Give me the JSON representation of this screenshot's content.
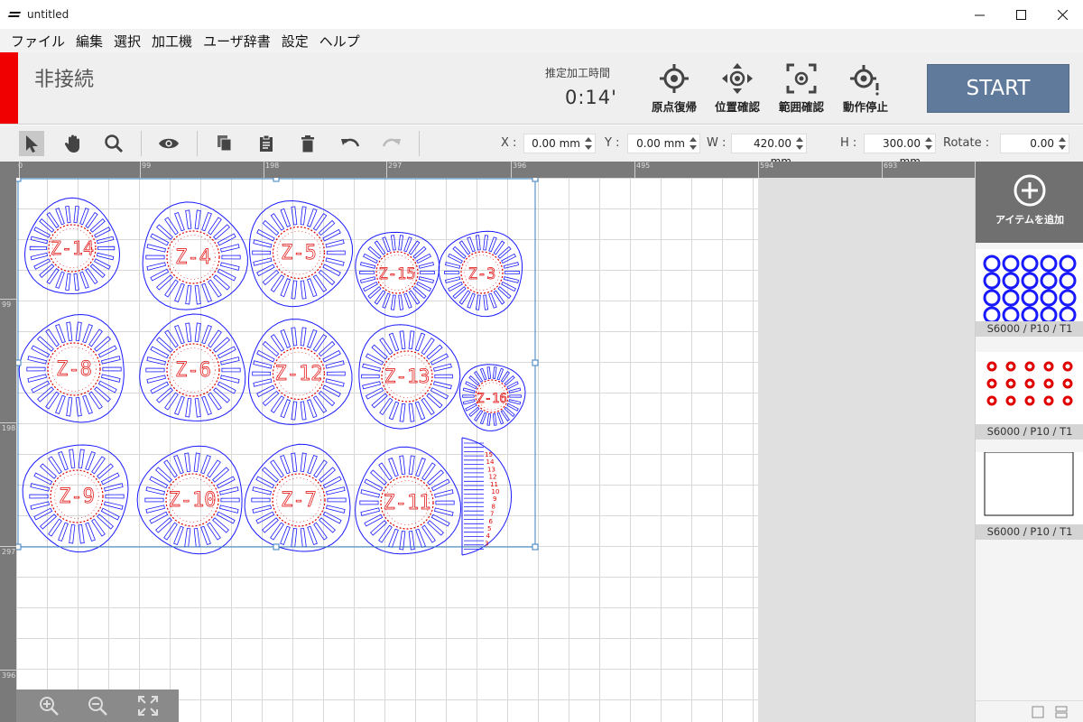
{
  "window": {
    "title": "untitled"
  },
  "menu": [
    "ファイル",
    "編集",
    "選択",
    "加工機",
    "ユーザ辞書",
    "設定",
    "ヘルプ"
  ],
  "header": {
    "connection_status": "非接続",
    "estimated_time_label": "推定加工時間",
    "estimated_time": "0:14'",
    "buttons": [
      "原点復帰",
      "位置確認",
      "範囲確認",
      "動作停止"
    ],
    "start_label": "START",
    "status_color": "#f00000"
  },
  "transform": {
    "x_label": "X :",
    "x_value": "0.00 mm",
    "y_label": "Y :",
    "y_value": "0.00 mm",
    "w_label": "W :",
    "w_value": "420.00 mm",
    "h_label": "H :",
    "h_value": "300.00 mm",
    "rotate_label": "Rotate :",
    "rotate_value": "0.00"
  },
  "rulers": {
    "top": [
      "0",
      "99",
      "198",
      "297",
      "396",
      "495",
      "594",
      "693"
    ],
    "left": [
      "99",
      "198",
      "297",
      "396"
    ]
  },
  "parts": [
    "Z-14",
    "Z-4",
    "Z-5",
    "Z-15",
    "Z-3",
    "Z-8",
    "Z-6",
    "Z-12",
    "Z-13",
    "Z-16",
    "Z-9",
    "Z-10",
    "Z-7",
    "Z-11"
  ],
  "side_labels": [
    "15",
    "14",
    "13",
    "12",
    "11",
    "10",
    "9",
    "8",
    "7",
    "6",
    "5",
    "4",
    "3"
  ],
  "right_panel": {
    "add_item_label": "アイテムを追加",
    "layers": [
      {
        "caption": "S6000 / P10 / T1",
        "color": "#1a1aff"
      },
      {
        "caption": "S6000 / P10 / T1",
        "color": "#e00000"
      },
      {
        "caption": "S6000 / P10 / T1",
        "color": "#000000"
      }
    ]
  },
  "colors": {
    "accent": "#5f7a9a",
    "cut_blue": "#1a1aff",
    "engrave_red": "#e00000"
  }
}
